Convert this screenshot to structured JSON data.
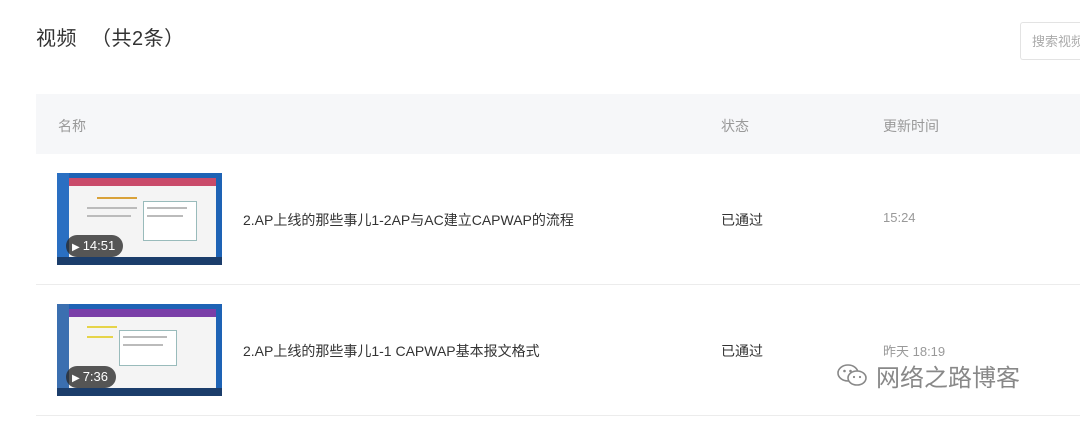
{
  "header": {
    "title": "视频",
    "count": "（共2条）"
  },
  "search": {
    "placeholder": "搜索视频"
  },
  "table": {
    "columns": {
      "name": "名称",
      "status": "状态",
      "time": "更新时间"
    },
    "rows": [
      {
        "duration": "14:51",
        "title": "2.AP上线的那些事儿1-2AP与AC建立CAPWAP的流程",
        "status": "已通过",
        "updated": "15:24"
      },
      {
        "duration": "7:36",
        "title": "2.AP上线的那些事儿1-1 CAPWAP基本报文格式",
        "status": "已通过",
        "updated": "昨天 18:19"
      }
    ]
  },
  "watermark": {
    "text": "网络之路博客",
    "icon": "wechat-icon"
  },
  "colors": {
    "status_text": "#333333",
    "muted_text": "#999999",
    "header_bg": "#f6f7f9"
  }
}
